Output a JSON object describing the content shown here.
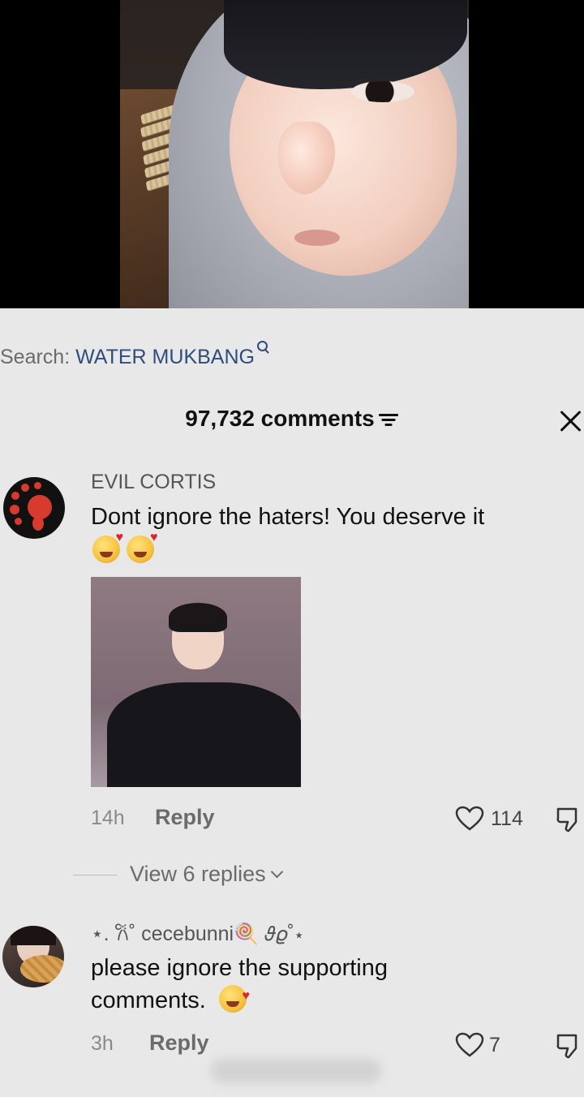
{
  "search": {
    "prefix": "Search:",
    "term": "WATER MUKBANG"
  },
  "comments": {
    "count_label": "97,732 comments",
    "items": [
      {
        "username": "EVIL CORTIS",
        "text": "Dont ignore the haters! You deserve it",
        "emoji": "🥰🥰",
        "time": "14h",
        "reply_label": "Reply",
        "likes": "114",
        "view_replies_label": "View 6 replies"
      },
      {
        "username": "⋆. 𐙚˚ cecebunni🍭 𝜗𝜚˚⋆",
        "text_line1": "please ignore the supporting",
        "text_line2": "comments.",
        "emoji": "🥰",
        "time": "3h",
        "reply_label": "Reply",
        "likes": "7"
      }
    ]
  },
  "icons": [
    "search-icon",
    "filter-icon",
    "close-icon",
    "heart-icon",
    "dislike-icon",
    "chevron-down-icon"
  ],
  "colors": {
    "background": "#e8e8e8",
    "search_term": "#2f4c7e",
    "secondary_text": "#6b6b6b"
  }
}
